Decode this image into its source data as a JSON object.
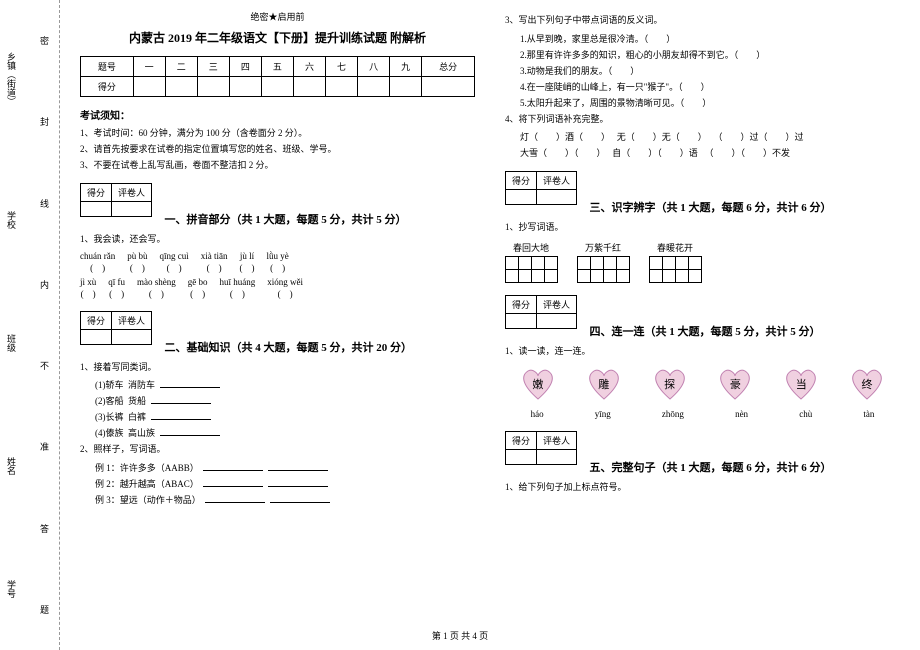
{
  "header": {
    "confidential": "绝密★启用前"
  },
  "title": "内蒙古 2019 年二年级语文【下册】提升训练试题 附解析",
  "score_table": {
    "header": [
      "题号",
      "一",
      "二",
      "三",
      "四",
      "五",
      "六",
      "七",
      "八",
      "九",
      "总分"
    ],
    "row2_label": "得分"
  },
  "notice": {
    "title": "考试须知：",
    "items": [
      "1、考试时间：60 分钟，满分为 100 分（含卷面分 2 分）。",
      "2、请首先按要求在试卷的指定位置填写您的姓名、班级、学号。",
      "3、不要在试卷上乱写乱画，卷面不整洁扣 2 分。"
    ]
  },
  "section_box": {
    "col1": "得分",
    "col2": "评卷人"
  },
  "sections": {
    "one": {
      "title": "一、拼音部分（共 1 大题，每题 5 分，共计 5 分）"
    },
    "two": {
      "title": "二、基础知识（共 4 大题，每题 5 分，共计 20 分）"
    },
    "three": {
      "title": "三、识字辨字（共 1 大题，每题 6 分，共计 6 分）"
    },
    "four": {
      "title": "四、连一连（共 1 大题，每题 5 分，共计 5 分）"
    },
    "five": {
      "title": "五、完整句子（共 1 大题，每题 6 分，共计 6 分）"
    }
  },
  "q1": {
    "stem": "1、我会读，还会写。",
    "pinyin1": [
      "chuán rǎn",
      "pù bù",
      "qīng cuì",
      "xià tiān",
      "jù lí",
      "lǜu yè"
    ],
    "pinyin2": [
      "jì xù",
      "qī fu",
      "mào shèng",
      "gē bo",
      "huī huáng",
      "xióng wěi"
    ]
  },
  "q2_1": {
    "stem": "1、接着写同类词。",
    "rows": [
      {
        "num": "(1)",
        "a": "轿车",
        "b": "消防车"
      },
      {
        "num": "(2)",
        "a": "客船",
        "b": "货船"
      },
      {
        "num": "(3)",
        "a": "长裤",
        "b": "白裤"
      },
      {
        "num": "(4)",
        "a": "傣族",
        "b": "高山族"
      }
    ]
  },
  "q2_2": {
    "stem": "2、照样子，写词语。",
    "ex1": "例 1：许许多多（AABB）",
    "ex2": "例 2：越升越高（ABAC）",
    "ex3": "例 3：望远（动作＋物品）"
  },
  "q3": {
    "stem": "3、写出下列句子中带点词语的反义词。",
    "items": [
      "1.从早到晚，家里总是很冷清。（　　）",
      "2.那里有许许多多的知识，粗心的小朋友却得不到它。（　　）",
      "3.动物是我们的朋友。（　　）",
      "4.在一座陡峭的山峰上，有一只\"猴子\"。（　　）",
      "5.太阳升起来了，周围的景物清晰可见。（　　）"
    ]
  },
  "q4": {
    "stem": "4、将下列词语补充完整。",
    "rows": [
      [
        "灯（　　）酒（　　）",
        "无（　　）无（　　）",
        "（　　）过（　　）过"
      ],
      [
        "大雪（　　）（　　）",
        "自（　　）（　　）语",
        "（　　）（　　）不发"
      ]
    ]
  },
  "q3_1": {
    "stem": "1、抄写词语。",
    "words": [
      "春回大地",
      "万紫千红",
      "春暖花开"
    ]
  },
  "q4_1": {
    "stem": "1、读一读，连一连。",
    "chars": [
      "嫩",
      "雕",
      "探",
      "豪",
      "当",
      "终"
    ],
    "pinyins": [
      "háo",
      "yīng",
      "zhōng",
      "nèn",
      "chù",
      "tàn"
    ]
  },
  "q5_1": {
    "stem": "1、给下列句子加上标点符号。"
  },
  "binding": {
    "outer": [
      "乡镇（街道）",
      "学校",
      "班级",
      "姓名",
      "学号"
    ],
    "inner": [
      "密",
      "封",
      "线",
      "内",
      "不",
      "准",
      "答",
      "题"
    ]
  },
  "footer": "第 1 页 共 4 页"
}
